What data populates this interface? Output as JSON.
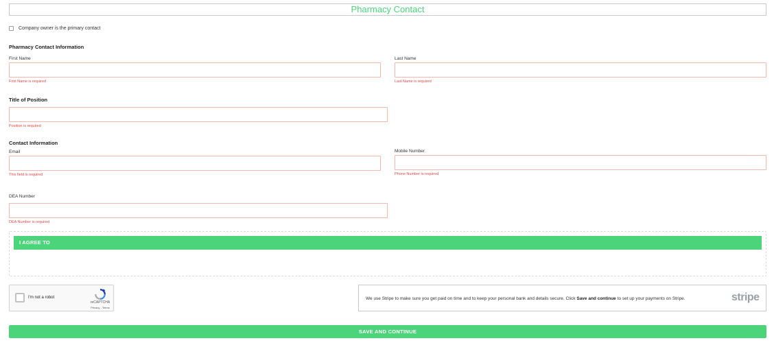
{
  "header": {
    "title": "Pharmacy Contact"
  },
  "owner_checkbox": {
    "label": "Company owner is the primary contact",
    "checked": false
  },
  "contact_info": {
    "heading": "Pharmacy Contact Information",
    "first_name": {
      "label": "First Name",
      "value": "",
      "error": "First Name is required"
    },
    "last_name": {
      "label": "Last Name",
      "value": "",
      "error": "Last Name is required"
    }
  },
  "position": {
    "heading": "Title of Position",
    "value": "",
    "error": "Position is required"
  },
  "contact": {
    "heading": "Contact Information",
    "email": {
      "label": "Email",
      "value": "",
      "error": "This field is required"
    },
    "mobile": {
      "label": "Mobile Number",
      "value": "",
      "error": "Phone Number is required"
    }
  },
  "dea": {
    "label": "DEA Number",
    "value": "",
    "error": "DEA Number is required"
  },
  "agree": {
    "label": "I AGREE TO"
  },
  "recaptcha": {
    "label": "I'm not a robot",
    "brand": "reCAPTCHA",
    "links": "Privacy - Terms",
    "icon": "recaptcha-icon"
  },
  "stripe": {
    "text_before": "We use Stripe to make sure you get paid on time and to keep your personal bank and details secure. Click ",
    "text_bold": "Save and continue",
    "text_after": " to set up your payments on Stripe.",
    "logo": "stripe"
  },
  "save_button": {
    "label": "SAVE AND CONTINUE"
  },
  "colors": {
    "accent": "#4cd47a",
    "error": "#e04848",
    "input_border": "#f2b8ad"
  }
}
